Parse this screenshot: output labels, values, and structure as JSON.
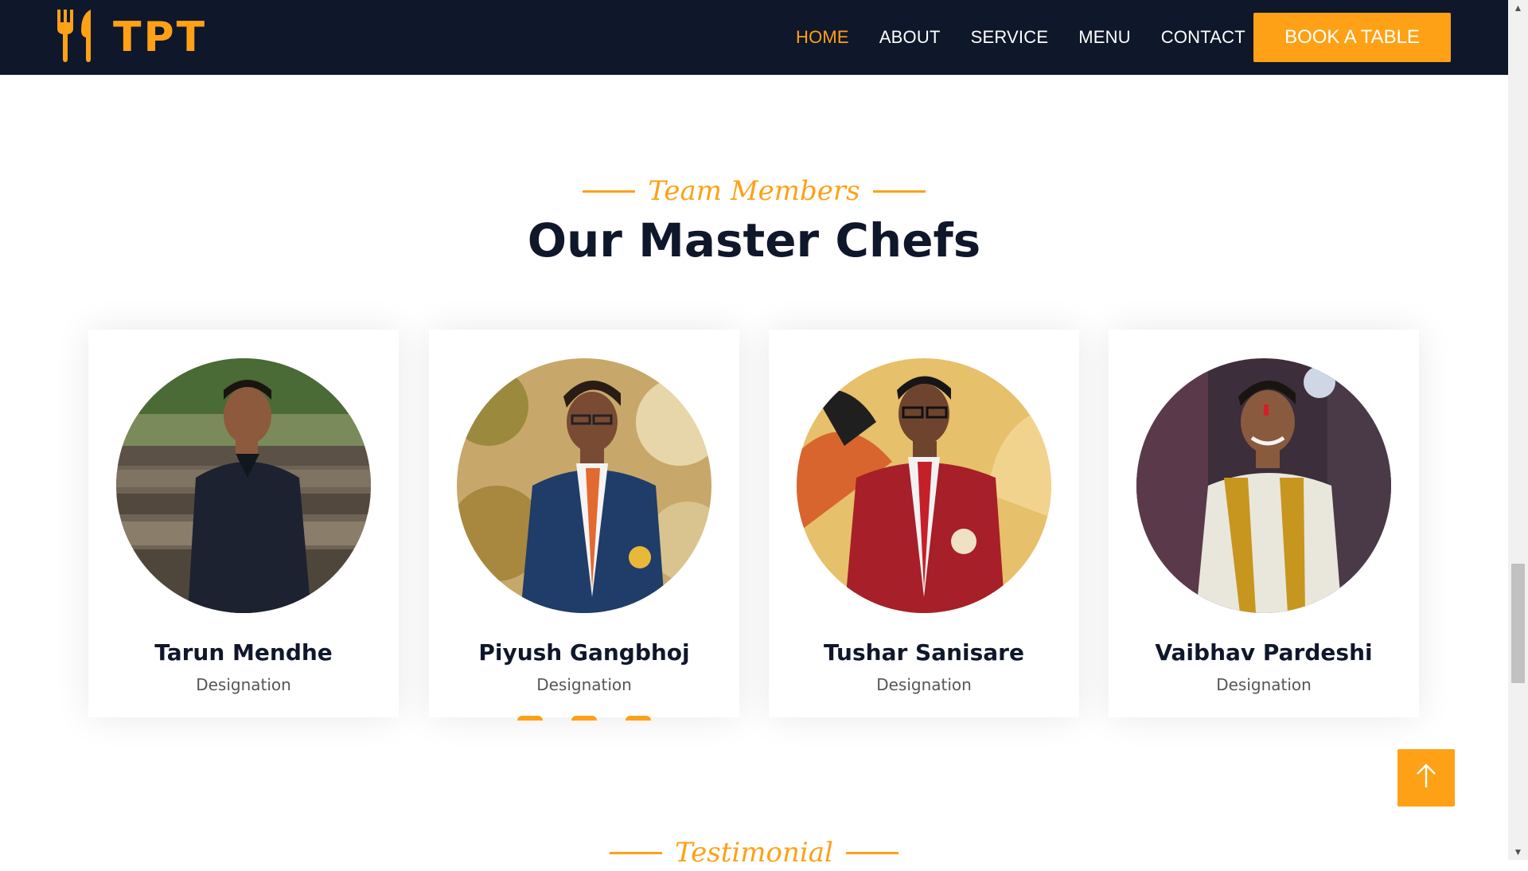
{
  "brand": {
    "name": "TPT",
    "icon": "utensils-icon"
  },
  "nav": {
    "items": [
      {
        "label": "HOME",
        "active": true
      },
      {
        "label": "ABOUT",
        "active": false
      },
      {
        "label": "SERVICE",
        "active": false
      },
      {
        "label": "MENU",
        "active": false
      },
      {
        "label": "CONTACT",
        "active": false
      }
    ],
    "cta_label": "BOOK A TABLE"
  },
  "team": {
    "subtitle": "Team Members",
    "title": "Our Master Chefs",
    "members": [
      {
        "name": "Tarun Mendhe",
        "role": "Designation"
      },
      {
        "name": "Piyush Gangbhoj",
        "role": "Designation"
      },
      {
        "name": "Tushar Sanisare",
        "role": "Designation"
      },
      {
        "name": "Vaibhav Pardeshi",
        "role": "Designation"
      }
    ]
  },
  "testimonial": {
    "subtitle": "Testimonial"
  },
  "back_to_top": {
    "icon": "arrow-up-icon"
  },
  "colors": {
    "primary": "#fea116",
    "dark": "#0f172b",
    "white": "#ffffff"
  }
}
